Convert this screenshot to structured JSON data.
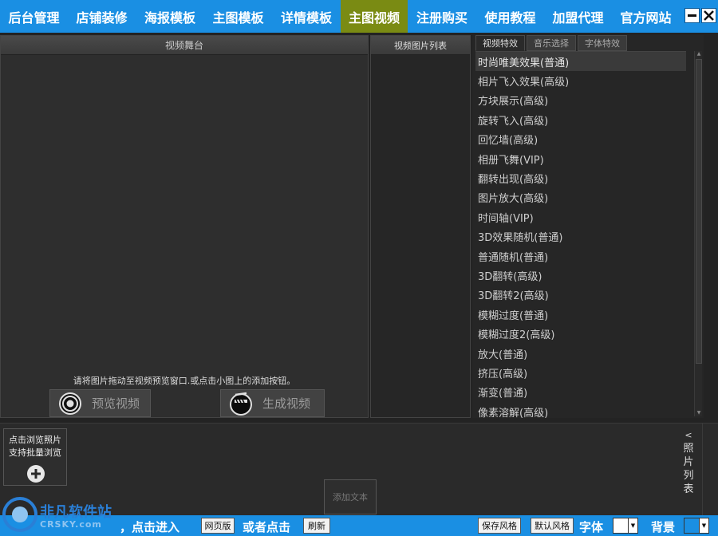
{
  "nav": {
    "items": [
      "后台管理",
      "店铺装修",
      "海报模板",
      "主图模板",
      "详情模板",
      "主图视频",
      "注册购买",
      "使用教程",
      "加盟代理",
      "官方网站"
    ],
    "active_index": 5
  },
  "window": {
    "minimize_icon": "minimize-icon",
    "close_icon": "close-icon"
  },
  "stage": {
    "title": "视频舞台",
    "hint": "请将图片拖动至视频预览窗口.或点击小图上的添加按钮。",
    "preview_label": "预览视频",
    "generate_label": "生成视频"
  },
  "photo_column": {
    "title": "视频图片列表"
  },
  "effects": {
    "tabs": [
      "视频特效",
      "音乐选择",
      "字体特效"
    ],
    "active_tab": 0,
    "items": [
      "时尚唯美效果(普通)",
      "相片飞入效果(高级)",
      "方块展示(高级)",
      "旋转飞入(高级)",
      "回忆墙(高级)",
      "相册飞舞(VIP)",
      "翻转出现(高级)",
      "图片放大(高级)",
      "时间轴(VIP)",
      "3D效果随机(普通)",
      "普通随机(普通)",
      "3D翻转(高级)",
      "3D翻转2(高级)",
      "模糊过度(普通)",
      "模糊过度2(高级)",
      "放大(普通)",
      "挤压(高级)",
      "渐变(普通)",
      "像素溶解(高级)"
    ],
    "selected_index": 0
  },
  "strip": {
    "browse_line1": "点击浏览照片",
    "browse_line2": "支持批量浏览",
    "add_text": "添加文本",
    "side_label": [
      "照",
      "片",
      "列",
      "表"
    ]
  },
  "bottombar": {
    "text1": "，点击进入",
    "web_btn": "网页版",
    "text2": "或者点击",
    "refresh_btn": "刷新",
    "save_style": "保存风格",
    "default_style": "默认风格",
    "font_label": "字体",
    "bg_label": "背景",
    "font_color": "#ffffff",
    "bg_color": "#1a8fe3"
  },
  "logo": {
    "name": "非凡软件站",
    "url": "CRSKY.com"
  }
}
